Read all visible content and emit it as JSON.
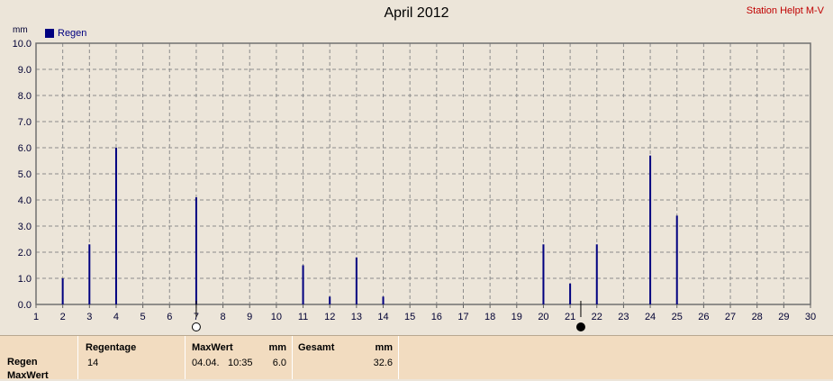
{
  "header": {
    "title": "April 2012",
    "station": "Station Helpt M-V",
    "unit": "mm",
    "legend": "Regen"
  },
  "colors": {
    "bar": "#000080",
    "background": "#ece5d9",
    "plot_bg": "#ece5d9",
    "grid": "#8c8c8c",
    "panel": "#f2dcc0",
    "station_text": "#c00000"
  },
  "chart_data": {
    "type": "bar",
    "title": "April 2012",
    "ylabel": "mm",
    "xlim": [
      1,
      30
    ],
    "ylim": [
      0,
      10
    ],
    "grid": true,
    "legend_position": "top-left",
    "series": [
      {
        "name": "Regen",
        "x": [
          2,
          3,
          4,
          7,
          11,
          12,
          13,
          14,
          20,
          21,
          22,
          24,
          25
        ],
        "values": [
          1.0,
          2.3,
          6.0,
          4.1,
          1.5,
          0.3,
          1.8,
          0.3,
          2.3,
          0.8,
          2.3,
          5.7,
          3.4
        ]
      }
    ],
    "x_ticks": [
      "1",
      "2",
      "3",
      "4",
      "5",
      "6",
      "7",
      "8",
      "9",
      "10",
      "11",
      "12",
      "13",
      "14",
      "15",
      "16",
      "17",
      "18",
      "19",
      "20",
      "21",
      "22",
      "23",
      "24",
      "25",
      "26",
      "27",
      "28",
      "29",
      "30"
    ],
    "y_ticks": [
      "0.0",
      "1.0",
      "2.0",
      "3.0",
      "4.0",
      "5.0",
      "6.0",
      "7.0",
      "8.0",
      "9.0",
      "10.0"
    ],
    "moon_phases": [
      {
        "x": 7,
        "phase": "full"
      },
      {
        "x": 21.4,
        "phase": "new"
      }
    ]
  },
  "summary": {
    "row_labels": [
      "Regen",
      "MaxWert"
    ],
    "regentage": {
      "label": "Regentage",
      "value": "14"
    },
    "maxwert": {
      "label": "MaxWert",
      "unit": "mm",
      "date": "04.04.",
      "time": "10:35",
      "value": "6.0"
    },
    "gesamt": {
      "label": "Gesamt",
      "unit": "mm",
      "value": "32.6"
    }
  }
}
